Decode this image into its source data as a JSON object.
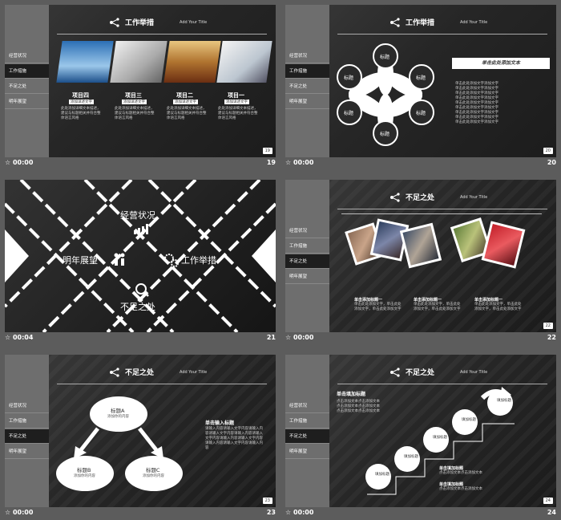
{
  "thumbnails": [
    {
      "id": "19",
      "header": {
        "title": "工作举措",
        "subtitle": "Add Your Title"
      },
      "sidebar": [
        "经营状况",
        "工作措施",
        "不足之处",
        "明年展望"
      ],
      "active_index": 1,
      "projects": [
        {
          "title": "项目四",
          "tag": "添加详述文字",
          "body": "此处添加详细文本描述，建议与标题相关并符合整体语言风格"
        },
        {
          "title": "项目三",
          "tag": "添加详述文字",
          "body": "此处添加详细文本描述，建议与标题相关并符合整体语言风格"
        },
        {
          "title": "项目二",
          "tag": "添加详述文字",
          "body": "此处添加详细文本描述，建议与标题相关并符合整体语言风格"
        },
        {
          "title": "项目一",
          "tag": "添加详述文字",
          "body": "此处添加详细文本描述，建议与标题相关并符合整体语言风格"
        }
      ],
      "page": "19",
      "footer_time": "00:00",
      "footer_num": "19"
    },
    {
      "id": "20",
      "header": {
        "title": "工作举措",
        "subtitle": "Add Your Title"
      },
      "sidebar": [
        "经营状况",
        "工作措施",
        "不足之处",
        "明年展望"
      ],
      "active_index": 1,
      "petals": [
        "标题",
        "标题",
        "标题",
        "标题",
        "标题",
        "标题"
      ],
      "banner": "单击此处添加文本",
      "lines": [
        "单击此处添加文字添加文字",
        "单击此处添加文字添加文字",
        "单击此处添加文字添加文字",
        "单击此处添加文字添加文字",
        "单击此处添加文字添加文字",
        "单击此处添加文字添加文字",
        "单击此处添加文字添加文字",
        "单击此处添加文字添加文字",
        "单击此处添加文字添加文字"
      ],
      "page": "20",
      "footer_time": "00:00",
      "footer_num": "20"
    },
    {
      "id": "21",
      "items": [
        {
          "label": "经营状况",
          "icon": "chart-icon"
        },
        {
          "label": "明年展望",
          "icon": "people-icon"
        },
        {
          "label": "工作举措",
          "icon": "gears-icon"
        },
        {
          "label": "不足之处",
          "icon": "magnifier-icon"
        }
      ],
      "footer_time": "00:04",
      "footer_num": "21"
    },
    {
      "id": "22",
      "header": {
        "title": "不足之处",
        "subtitle": "Add Your Title"
      },
      "sidebar": [
        "经营状况",
        "工作措施",
        "不足之处",
        "明年展望"
      ],
      "active_index": 2,
      "captions": [
        {
          "title": "单击添加标题一",
          "body": "单击此处添加文字，单击此处添加文字，单击此处添加文字"
        },
        {
          "title": "单击添加标题一",
          "body": "单击此处添加文字，单击此处添加文字，单击此处添加文字"
        },
        {
          "title": "单击添加标题一",
          "body": "单击此处添加文字，单击此处添加文字，单击此处添加文字"
        }
      ],
      "page": "22",
      "footer_time": "00:00",
      "footer_num": "22"
    },
    {
      "id": "23",
      "header": {
        "title": "不足之处",
        "subtitle": "Add Your Title"
      },
      "sidebar": [
        "经营状况",
        "工作措施",
        "不足之处",
        "明年展望"
      ],
      "active_index": 2,
      "nodes": [
        {
          "title": "标题A",
          "body": "添加你的内容"
        },
        {
          "title": "标题B",
          "body": "添加你的内容"
        },
        {
          "title": "标题C",
          "body": "添加你的内容"
        }
      ],
      "side_title": "单击输入标题",
      "side_body": "请输入内容请输入文字内容请输入内容请输入文字内容请输入内容请输入文字内容请输入内容请输入文字内容请输入内容请输入文字内容请输入内容",
      "page": "23",
      "footer_time": "00:00",
      "footer_num": "23"
    },
    {
      "id": "24",
      "header": {
        "title": "不足之处",
        "subtitle": "Add Your Title"
      },
      "sidebar": [
        "经营状况",
        "工作措施",
        "不足之处",
        "明年展望"
      ],
      "active_index": 2,
      "top_title": "单击填加标题",
      "top_lines": [
        "点击添加文本点击添加文本",
        "点击添加文本点击添加文本",
        "点击添加文本点击添加文本"
      ],
      "steps": [
        "填加标题",
        "填加标题",
        "填加标题",
        "填加标题",
        "填加标题"
      ],
      "mid_title": "单击填加标题",
      "mid_line": "点击添加文本点击添加文本",
      "bot_title": "单击填加标题",
      "bot_line": "点击添加文本点击添加文本",
      "page": "24",
      "footer_time": "00:00",
      "footer_num": "24"
    }
  ]
}
